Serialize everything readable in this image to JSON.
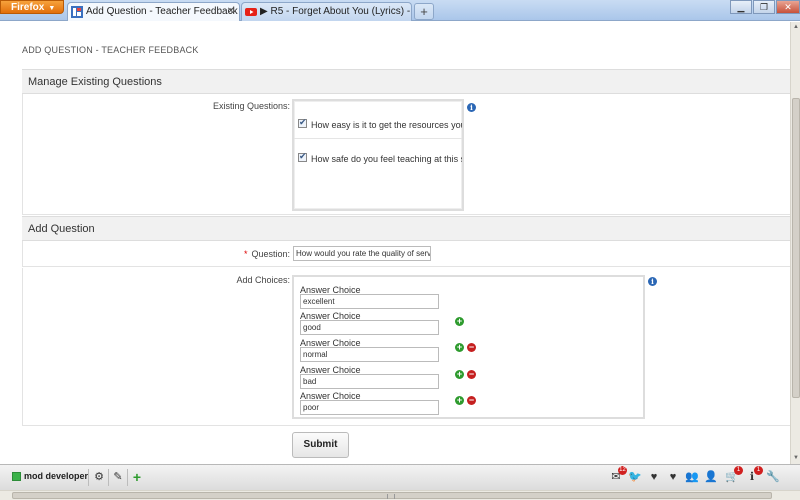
{
  "browser": {
    "menu_label": "Firefox",
    "tabs": [
      {
        "label": "Add Question - Teacher Feedback",
        "active": true
      },
      {
        "label": "▶ R5 - Forget About You (Lyrics) - Yo...",
        "active": false
      }
    ],
    "new_tab": "+"
  },
  "page": {
    "title": "ADD QUESTION - TEACHER FEEDBACK",
    "manage_section": {
      "heading": "Manage Existing Questions",
      "existing_label": "Existing Questions:",
      "questions": [
        {
          "text": "How easy is it to get the resources you need",
          "checked": true
        },
        {
          "text": "How safe do you feel teaching at this school",
          "checked": true
        }
      ]
    },
    "add_section": {
      "heading": "Add Question",
      "required_mark": "*",
      "question_label": "Question:",
      "question_value": "How would you rate the quality  of service",
      "choices_label": "Add Choices:",
      "choice_label": "Answer Choice",
      "choices": [
        "excellent",
        "good",
        "normal",
        "bad",
        "poor"
      ]
    },
    "submit_label": "Submit"
  },
  "dev_toolbar": {
    "label": "mod developer",
    "badges": {
      "messages": "12",
      "cart": "1",
      "info": "1"
    }
  },
  "colors": {
    "accent_blue": "#2b67b5",
    "add_green": "#2e9b2e",
    "remove_red": "#c52020",
    "badge_red": "#d12020"
  }
}
